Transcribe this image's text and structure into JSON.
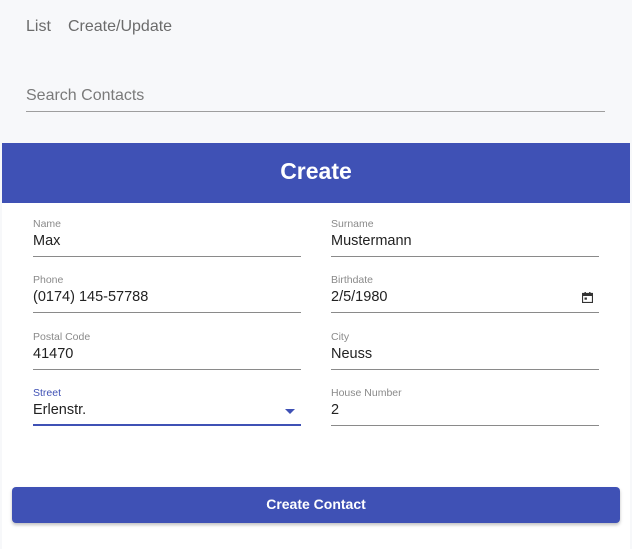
{
  "nav": {
    "list_label": "List",
    "create_update_label": "Create/Update"
  },
  "search": {
    "placeholder": "Search Contacts",
    "value": ""
  },
  "form": {
    "title": "Create",
    "name": {
      "label": "Name",
      "value": "Max"
    },
    "surname": {
      "label": "Surname",
      "value": "Mustermann"
    },
    "phone": {
      "label": "Phone",
      "value": "(0174) 145-57788"
    },
    "birthdate": {
      "label": "Birthdate",
      "value": "2/5/1980",
      "icon": "calendar-icon"
    },
    "postal_code": {
      "label": "Postal Code",
      "value": "41470"
    },
    "city": {
      "label": "City",
      "value": "Neuss"
    },
    "street": {
      "label": "Street",
      "value": "Erlenstr.",
      "icon": "chevron-down-icon"
    },
    "house_number": {
      "label": "House Number",
      "value": "2"
    },
    "submit_label": "Create Contact"
  },
  "colors": {
    "primary": "#3f51b5",
    "background": "#f7f8fa",
    "card": "#ffffff"
  }
}
